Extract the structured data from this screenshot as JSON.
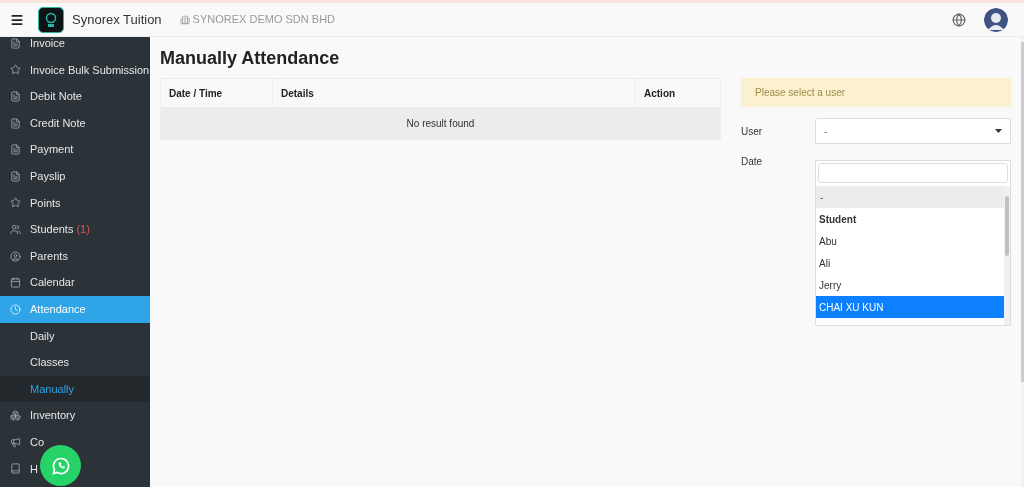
{
  "topbar": {
    "app_name": "Synorex Tuition",
    "company": "SYNOREX DEMO SDN BHD"
  },
  "sidebar": {
    "items": [
      {
        "label": "Invoice",
        "selected": false
      },
      {
        "label": "Invoice Bulk Submission",
        "selected": false
      },
      {
        "label": "Debit Note",
        "selected": false
      },
      {
        "label": "Credit Note",
        "selected": false
      },
      {
        "label": "Payment",
        "selected": false
      },
      {
        "label": "Payslip",
        "selected": false
      },
      {
        "label": "Points",
        "selected": false
      },
      {
        "label": "Students",
        "badge": "(1)",
        "selected": false
      },
      {
        "label": "Parents",
        "selected": false
      },
      {
        "label": "Calendar",
        "selected": false
      },
      {
        "label": "Attendance",
        "selected": true,
        "children": [
          {
            "label": "Daily",
            "selected": false
          },
          {
            "label": "Classes",
            "selected": false
          },
          {
            "label": "Manually",
            "selected": true
          }
        ]
      },
      {
        "label": "Inventory",
        "selected": false
      },
      {
        "label": "Co",
        "selected": false
      },
      {
        "label": "H",
        "selected": false
      }
    ]
  },
  "page_title": "Manually Attendance",
  "table": {
    "columns": [
      "Date / Time",
      "Details",
      "Action"
    ],
    "empty_text": "No result found"
  },
  "form": {
    "alert": "Please select a user",
    "user_label": "User",
    "user_value": "-",
    "date_label": "Date",
    "options": [
      {
        "kind": "option",
        "label": "-",
        "current": true,
        "selected": false
      },
      {
        "kind": "group",
        "label": "Student"
      },
      {
        "kind": "option",
        "label": "Abu",
        "current": false,
        "selected": false
      },
      {
        "kind": "option",
        "label": "Ali",
        "current": false,
        "selected": false
      },
      {
        "kind": "option",
        "label": "Jerry",
        "current": false,
        "selected": false
      },
      {
        "kind": "option",
        "label": "CHAI XU KUN",
        "current": false,
        "selected": true
      }
    ]
  }
}
